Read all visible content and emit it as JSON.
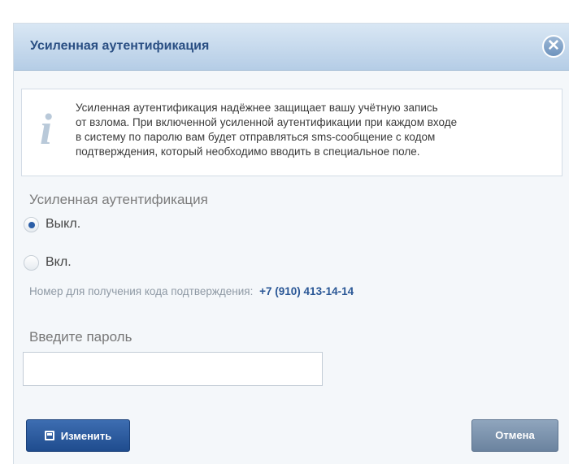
{
  "dialog": {
    "title": "Усиленная аутентификация",
    "close_glyph": "✕",
    "close_icon": "close-circle-icon"
  },
  "info": {
    "icon": "info-icon",
    "icon_glyph": "i",
    "lines": [
      "Усиленная аутентификация надёжнее защищает вашу учётную запись",
      "от взлома. При включенной усиленной аутентификации при каждом входе",
      "в систему по паролю вам будет отправляться sms-сообщение с кодом",
      "подтверждения, который необходимо вводить в специальное поле."
    ]
  },
  "auth": {
    "section_label": "Усиленная аутентификация",
    "options": [
      {
        "label": "Выкл.",
        "checked": true
      },
      {
        "label": "Вкл.",
        "checked": false
      }
    ]
  },
  "phone": {
    "caption": "Номер для получения кода подтверждения:",
    "number": "+7 (910) 413-14-14"
  },
  "password": {
    "label": "Введите пароль",
    "value": ""
  },
  "buttons": {
    "change_label": "Изменить",
    "change_icon": "save-disk-icon",
    "cancel_label": "Отмена"
  },
  "colors": {
    "header_title": "#2a4f83",
    "primary_button": "#2b5ea7",
    "secondary_button": "#7b92ad",
    "phone_number": "#2a5796"
  }
}
